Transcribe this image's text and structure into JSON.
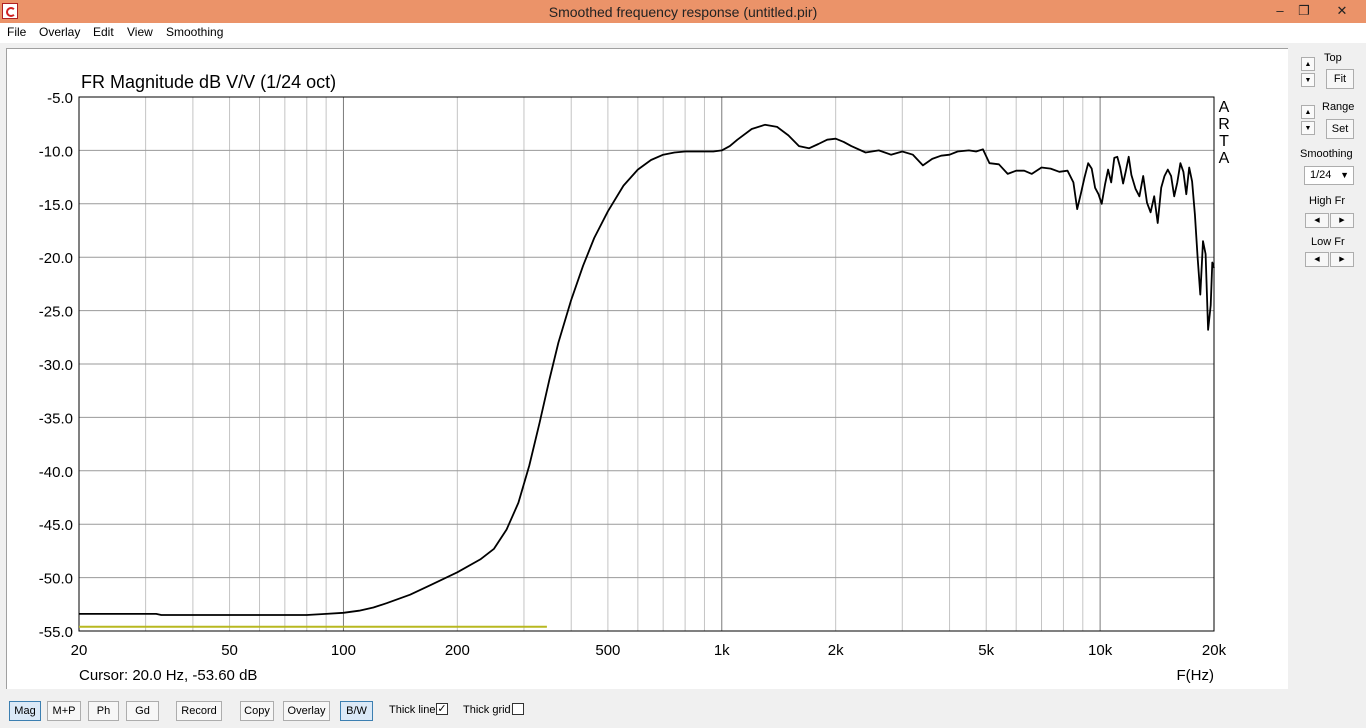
{
  "window": {
    "title": "Smoothed frequency response (untitled.pir)",
    "buttons": {
      "minimize": "–",
      "restore": "❐",
      "close": "✕"
    },
    "accent": "#eb9369"
  },
  "menu": [
    "File",
    "Overlay",
    "Edit",
    "View",
    "Smoothing"
  ],
  "side_panel": {
    "top_label": "Top",
    "fit_label": "Fit",
    "range_label": "Range",
    "set_label": "Set",
    "smoothing_label": "Smoothing",
    "smoothing_value": "1/24",
    "high_fr_label": "High Fr",
    "low_fr_label": "Low Fr"
  },
  "bottom_bar": {
    "buttons": [
      "Mag",
      "M+P",
      "Ph",
      "Gd",
      "Record",
      "Copy",
      "Overlay",
      "B/W"
    ],
    "active": "Mag",
    "thick_line_label": "Thick line",
    "thick_line_checked": true,
    "thick_grid_label": "Thick grid",
    "thick_grid_checked": false
  },
  "chart_data": {
    "type": "line",
    "title": "FR Magnitude dB V/V (1/24 oct)",
    "xlabel": "F(Hz)",
    "ylabel": "",
    "x_scale": "log",
    "xlim": [
      20,
      20000
    ],
    "ylim": [
      -55,
      -5
    ],
    "x_ticks": [
      {
        "v": 20,
        "label": "20"
      },
      {
        "v": 50,
        "label": "50"
      },
      {
        "v": 100,
        "label": "100"
      },
      {
        "v": 200,
        "label": "200"
      },
      {
        "v": 500,
        "label": "500"
      },
      {
        "v": 1000,
        "label": "1k"
      },
      {
        "v": 2000,
        "label": "2k"
      },
      {
        "v": 5000,
        "label": "5k"
      },
      {
        "v": 10000,
        "label": "10k"
      },
      {
        "v": 20000,
        "label": "20k"
      }
    ],
    "y_ticks": [
      {
        "v": -5,
        "label": "-5.0"
      },
      {
        "v": -10,
        "label": "-10.0"
      },
      {
        "v": -15,
        "label": "-15.0"
      },
      {
        "v": -20,
        "label": "-20.0"
      },
      {
        "v": -25,
        "label": "-25.0"
      },
      {
        "v": -30,
        "label": "-30.0"
      },
      {
        "v": -35,
        "label": "-35.0"
      },
      {
        "v": -40,
        "label": "-40.0"
      },
      {
        "v": -45,
        "label": "-45.0"
      },
      {
        "v": -50,
        "label": "-50.0"
      },
      {
        "v": -55,
        "label": "-55.0"
      }
    ],
    "grid": true,
    "watermark": "ARTA",
    "cursor_text": "Cursor: 20.0 Hz, -53.60 dB",
    "series": [
      {
        "color": "#000000",
        "x": [
          20,
          32,
          33,
          50,
          80,
          90,
          100,
          110,
          120,
          130,
          150,
          170,
          200,
          230,
          250,
          270,
          290,
          310,
          330,
          350,
          370,
          400,
          430,
          460,
          500,
          550,
          600,
          650,
          700,
          750,
          800,
          850,
          900,
          950,
          1000,
          1050,
          1100,
          1200,
          1300,
          1400,
          1500,
          1600,
          1700,
          1800,
          1900,
          2000,
          2100,
          2200,
          2400,
          2600,
          2800,
          3000,
          3200,
          3400,
          3600,
          3800,
          4000,
          4200,
          4500,
          4700,
          4900,
          5100,
          5400,
          5700,
          6000,
          6300,
          6600,
          7000,
          7400,
          7800,
          8200,
          8500,
          8700,
          8900,
          9100,
          9300,
          9500,
          9700,
          9900,
          10100,
          10300,
          10500,
          10700,
          10900,
          11100,
          11300,
          11500,
          11700,
          11900,
          12100,
          12400,
          12700,
          13000,
          13300,
          13600,
          13900,
          14200,
          14500,
          14800,
          15100,
          15400,
          15700,
          16000,
          16300,
          16600,
          16900,
          17200,
          17500,
          17800,
          18100,
          18400,
          18700,
          19000,
          19300,
          19600,
          19800,
          20000
        ],
        "y": [
          -53.4,
          -53.4,
          -53.5,
          -53.5,
          -53.5,
          -53.4,
          -53.3,
          -53.1,
          -52.8,
          -52.4,
          -51.6,
          -50.7,
          -49.5,
          -48.3,
          -47.3,
          -45.5,
          -43.0,
          -39.5,
          -35.5,
          -31.5,
          -28.0,
          -24.0,
          -20.8,
          -18.2,
          -15.7,
          -13.3,
          -11.8,
          -10.9,
          -10.4,
          -10.2,
          -10.1,
          -10.1,
          -10.1,
          -10.1,
          -10.0,
          -9.6,
          -9.0,
          -8.0,
          -7.6,
          -7.8,
          -8.6,
          -9.6,
          -9.8,
          -9.4,
          -9.0,
          -8.9,
          -9.2,
          -9.6,
          -10.2,
          -10.0,
          -10.4,
          -10.1,
          -10.4,
          -11.4,
          -10.8,
          -10.5,
          -10.4,
          -10.1,
          -10.0,
          -10.1,
          -9.9,
          -11.2,
          -11.3,
          -12.2,
          -11.9,
          -11.9,
          -12.2,
          -11.6,
          -11.7,
          -12.0,
          -11.9,
          -13.0,
          -15.5,
          -14.0,
          -12.5,
          -11.2,
          -11.7,
          -13.5,
          -14.1,
          -15.0,
          -13.2,
          -11.8,
          -13.0,
          -10.7,
          -10.6,
          -11.6,
          -13.1,
          -11.9,
          -10.6,
          -12.3,
          -13.6,
          -14.3,
          -12.4,
          -14.9,
          -15.8,
          -14.3,
          -16.8,
          -13.5,
          -12.4,
          -11.8,
          -12.4,
          -14.3,
          -13.0,
          -11.2,
          -12.0,
          -14.1,
          -11.6,
          -12.9,
          -16.0,
          -20.0,
          -23.5,
          -18.5,
          -19.7,
          -26.8,
          -24.5,
          -20.5,
          -21.0
        ]
      },
      {
        "color": "#b8b820",
        "x": [
          20,
          345
        ],
        "y": [
          -54.6,
          -54.6
        ]
      }
    ]
  }
}
